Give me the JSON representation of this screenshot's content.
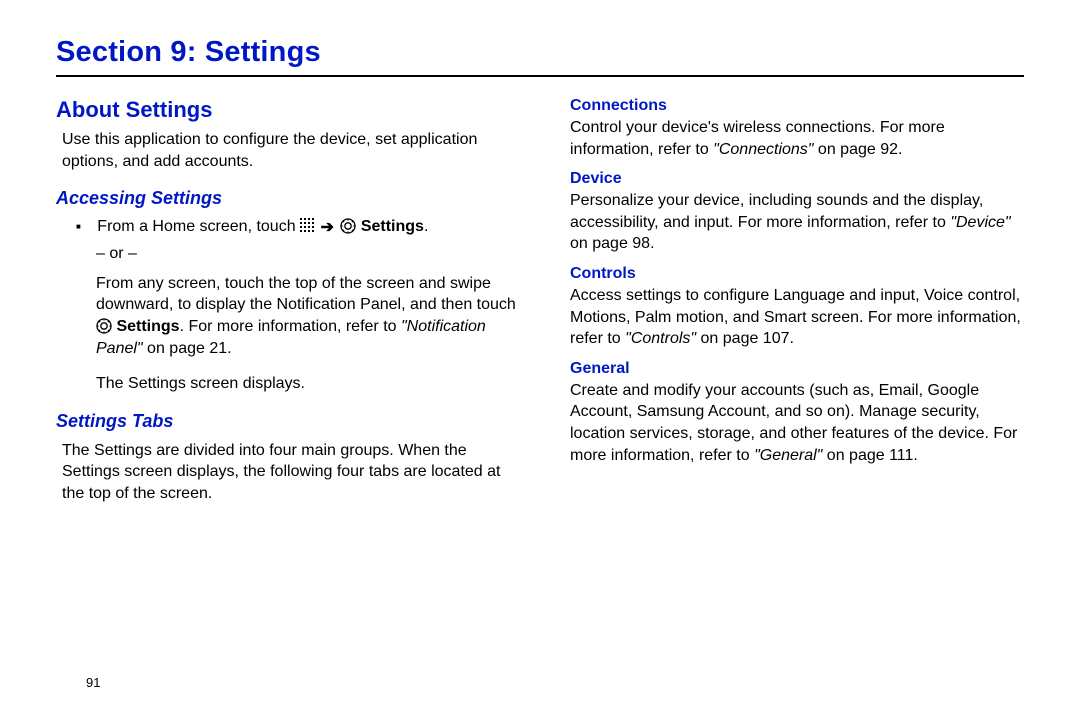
{
  "section_title": "Section 9: Settings",
  "left": {
    "about_heading": "About Settings",
    "about_body": "Use this application to configure the device, set application options, and add accounts.",
    "accessing": {
      "heading": "Accessing Settings",
      "line1_prefix": "From a Home screen, touch ",
      "line1_settings": "Settings",
      "line1_suffix": ".",
      "or_text": "– or –",
      "para2_a": "From any screen, touch the top of the screen and swipe downward, to display the Notification Panel, and then touch ",
      "para2_settings": "Settings",
      "para2_b": ". For more information, refer to ",
      "para2_ref": "\"Notification Panel\"",
      "para2_c": " on page 21.",
      "displays": "The Settings screen displays."
    },
    "tabs": {
      "heading": "Settings Tabs",
      "body": "The Settings are divided into four main groups. When the Settings screen displays, the following four tabs are located at the top of the screen."
    }
  },
  "right": {
    "connections": {
      "heading": "Connections",
      "body_a": "Control your device's wireless connections. For more information, refer to ",
      "ref": "\"Connections\"",
      "body_b": " on page 92."
    },
    "device": {
      "heading": "Device",
      "body_a": "Personalize your device, including sounds and the display, accessibility, and input. For more information, refer to ",
      "ref": "\"Device\"",
      "body_b": " on page 98."
    },
    "controls": {
      "heading": "Controls",
      "body_a": "Access settings to configure Language and input, Voice control, Motions, Palm motion, and Smart screen. For more information, refer to ",
      "ref": "\"Controls\"",
      "body_b": " on page 107."
    },
    "general": {
      "heading": "General",
      "body_a": "Create and modify your accounts (such as, Email, Google Account, Samsung Account, and so on). Manage security, location services, storage, and other features of the device. For more information, refer to ",
      "ref": "\"General\"",
      "body_b": " on page 111."
    }
  },
  "page_number": "91"
}
